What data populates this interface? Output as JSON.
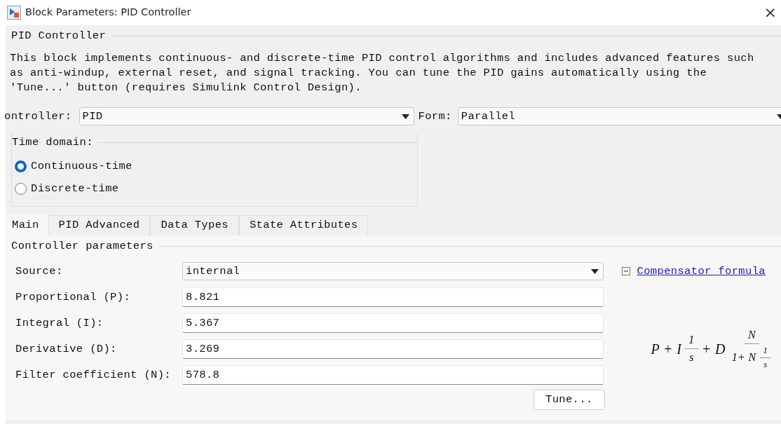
{
  "window": {
    "title": "Block Parameters: PID Controller",
    "close": "×"
  },
  "block": {
    "title": "PID Controller",
    "description": [
      "This block implements continuous- and discrete-time PID control algorithms and includes advanced features such",
      "as anti-windup, external reset, and signal tracking. You can tune the PID gains automatically using the",
      "'Tune...' button (requires Simulink Control Design)."
    ]
  },
  "controller": {
    "label": "ontroller:",
    "value": "PID"
  },
  "form": {
    "label": "Form:",
    "value": "Parallel"
  },
  "time_domain": {
    "title": "Time domain:",
    "options": [
      {
        "label": "Continuous-time",
        "selected": true
      },
      {
        "label": "Discrete-time",
        "selected": false
      }
    ]
  },
  "tabs": [
    {
      "label": "Main",
      "selected": true
    },
    {
      "label": "PID Advanced",
      "selected": false
    },
    {
      "label": "Data Types",
      "selected": false
    },
    {
      "label": "State Attributes",
      "selected": false
    }
  ],
  "parameters": {
    "title": "Controller parameters",
    "rows": [
      {
        "kind": "dropdown",
        "label": "Source:",
        "value": "internal"
      },
      {
        "kind": "field",
        "label": "Proportional (P):",
        "value": "8.821"
      },
      {
        "kind": "field",
        "label": "Integral (I):",
        "value": "5.367"
      },
      {
        "kind": "field",
        "label": "Derivative (D):",
        "value": "3.269"
      },
      {
        "kind": "field",
        "label": "Filter coefficient (N):",
        "value": "578.8"
      }
    ],
    "button": "Tune..."
  },
  "formula_panel": {
    "expanded": true,
    "link": "Compensator formula",
    "formula": [
      {
        "kind": "text",
        "text": "P + I"
      },
      {
        "kind": "frac",
        "num": [
          {
            "kind": "text",
            "text": "1"
          }
        ],
        "den": [
          {
            "kind": "text",
            "text": "s"
          }
        ]
      },
      {
        "kind": "text",
        "text": "+ D"
      },
      {
        "kind": "frac",
        "num": [
          {
            "kind": "text",
            "text": "N"
          }
        ],
        "den": [
          {
            "kind": "text",
            "text": "1+ N"
          },
          {
            "kind": "frac",
            "num": [
              {
                "kind": "text",
                "text": "1"
              }
            ],
            "den": [
              {
                "kind": "text",
                "text": "s"
              }
            ]
          }
        ]
      }
    ]
  }
}
